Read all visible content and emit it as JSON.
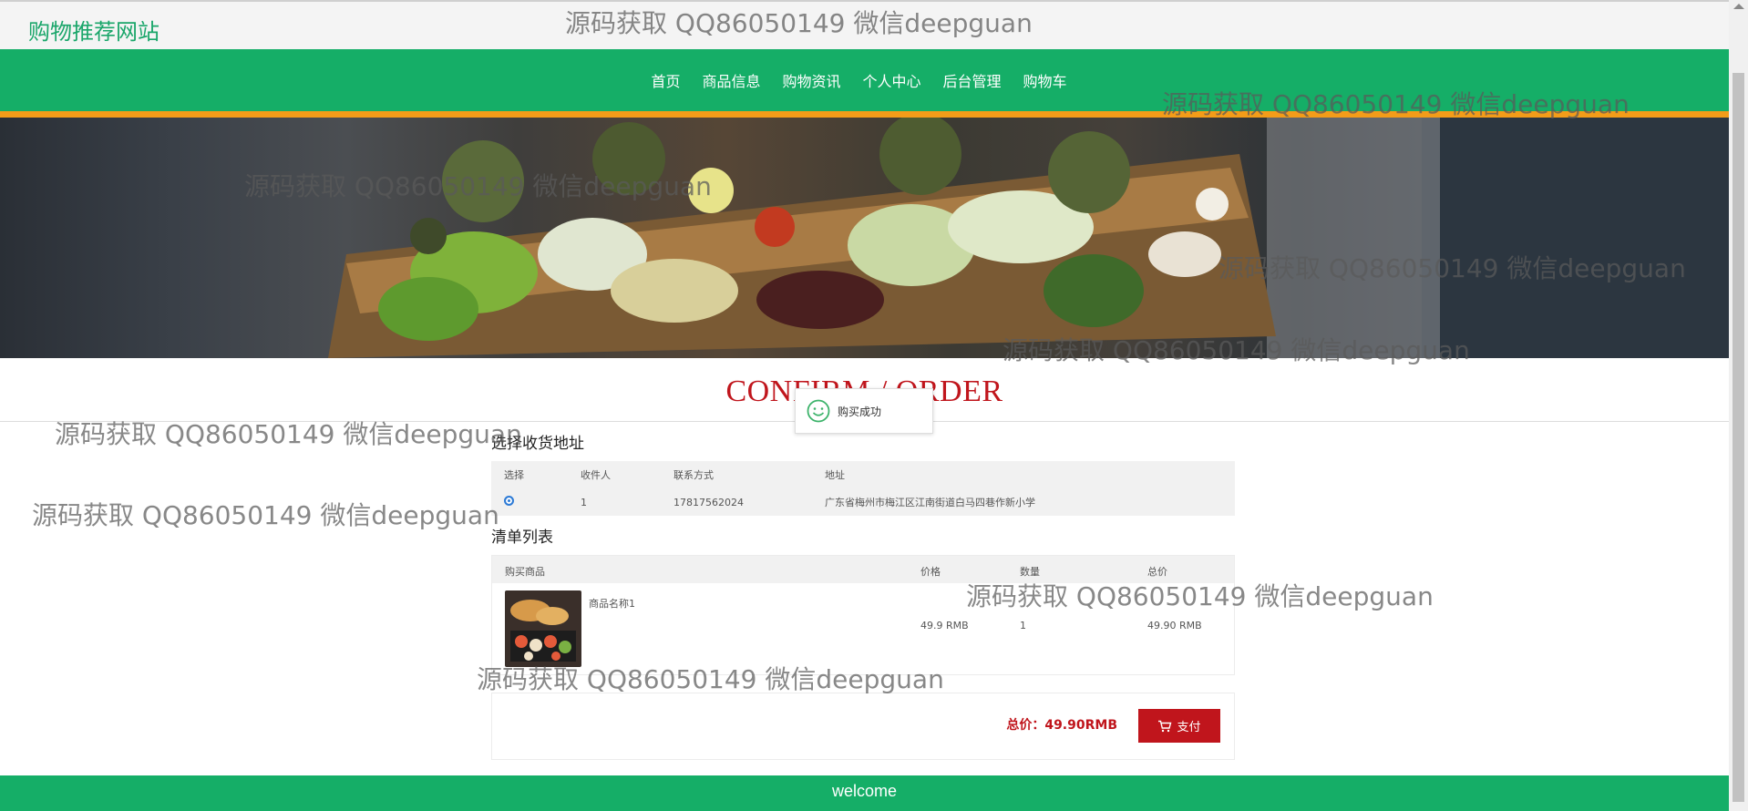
{
  "site": {
    "title": "购物推荐网站"
  },
  "nav": {
    "items": [
      "首页",
      "商品信息",
      "购物资讯",
      "个人中心",
      "后台管理",
      "购物车"
    ]
  },
  "section": {
    "title": "CONFIRM / ORDER"
  },
  "toast": {
    "message": "购买成功"
  },
  "address": {
    "heading": "选择收货地址",
    "columns": [
      "选择",
      "收件人",
      "联系方式",
      "地址"
    ],
    "rows": [
      {
        "selected": true,
        "recipient": "1",
        "phone": "17817562024",
        "address": "广东省梅州市梅江区江南街道白马四巷作新小学"
      }
    ]
  },
  "order": {
    "heading": "清单列表",
    "columns": [
      "购买商品",
      "价格",
      "数量",
      "总价"
    ],
    "items": [
      {
        "name": "商品名称1",
        "price": "49.9 RMB",
        "quantity": "1",
        "total": "49.90 RMB"
      }
    ]
  },
  "summary": {
    "total_label": "总价：49.90RMB",
    "pay_label": "支付"
  },
  "footer": {
    "text": "welcome"
  },
  "watermark": {
    "text": "源码获取 QQ86050149 微信deepguan"
  },
  "colors": {
    "brand_green": "#15ae67",
    "accent_orange": "#f39c19",
    "accent_red": "#c0151c"
  },
  "icons": {
    "toast": "smiley-icon",
    "pay": "cart-icon"
  }
}
